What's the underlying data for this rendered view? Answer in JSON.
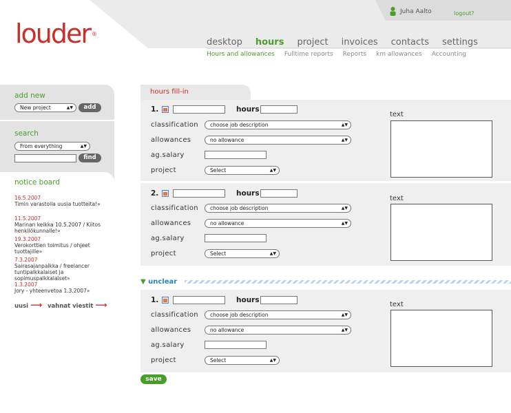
{
  "brand": {
    "logo_text": "louder",
    "registered": "®"
  },
  "user": {
    "name": "Juha Aalto",
    "logout": "logout?"
  },
  "nav": {
    "main": [
      "desktop",
      "hours",
      "project",
      "invoices",
      "contacts",
      "settings"
    ],
    "main_active": "hours",
    "sub": [
      "Hours and allowances",
      "Fulltime reports",
      "Reports",
      "km allowances",
      "Accounting"
    ],
    "sub_active": "Hours and allowances"
  },
  "sidebar": {
    "add_new": {
      "title": "add new",
      "select": "New project",
      "button": "add"
    },
    "search": {
      "title": "search",
      "select": "From everything",
      "input": "",
      "button": "find"
    },
    "notice_board": {
      "title": "notice board",
      "items": [
        {
          "date": "16.5.2007",
          "text": "Timin varastolla uusia tuotteita!»"
        },
        {
          "date": "11.5.2007",
          "text": "Marinan keikka 10.5.2007 / Kiitos henkilökunnalle!»"
        },
        {
          "date": "19.3.2007",
          "text": "Verokorttien toimitus / ohjeet tuottajille»"
        },
        {
          "date": "7.3.2007",
          "text": "Sairasajanpalkka / freelancer tuntipalkkalaiset ja sopimuspalkkalaiset»"
        },
        {
          "date": "1.3.2007",
          "text": "Jory - yhteenvetoa 1.3.2007»"
        }
      ],
      "new_link": "uusi",
      "old_link": "vahnat viestit"
    }
  },
  "form": {
    "tab_title": "hours fill-in",
    "labels": {
      "hours": "hours",
      "classification": "classification",
      "allowances": "allowances",
      "ag_salary": "ag.salary",
      "project": "project",
      "text": "text"
    },
    "entries": [
      {
        "number": "1.",
        "date": "",
        "hours": "",
        "classification": "choose job description",
        "allowance": "no allowance",
        "ag_salary": "",
        "project": "Select",
        "text": ""
      },
      {
        "number": "2.",
        "date": "",
        "hours": "",
        "classification": "choose job description",
        "allowance": "no allowance",
        "ag_salary": "",
        "project": "Select",
        "text": ""
      }
    ],
    "unclear": {
      "title": "unclear",
      "entries": [
        {
          "number": "1.",
          "date": "",
          "hours": "",
          "classification": "choose job description",
          "allowance": "no allowance",
          "ag_salary": "",
          "project": "Select",
          "text": ""
        }
      ]
    },
    "save_button": "save"
  },
  "colors": {
    "brand_red": "#c8302c",
    "accent_green": "#4a9d2a",
    "unclear_blue": "#2d7fc1",
    "panel_gray": "#efefef"
  }
}
